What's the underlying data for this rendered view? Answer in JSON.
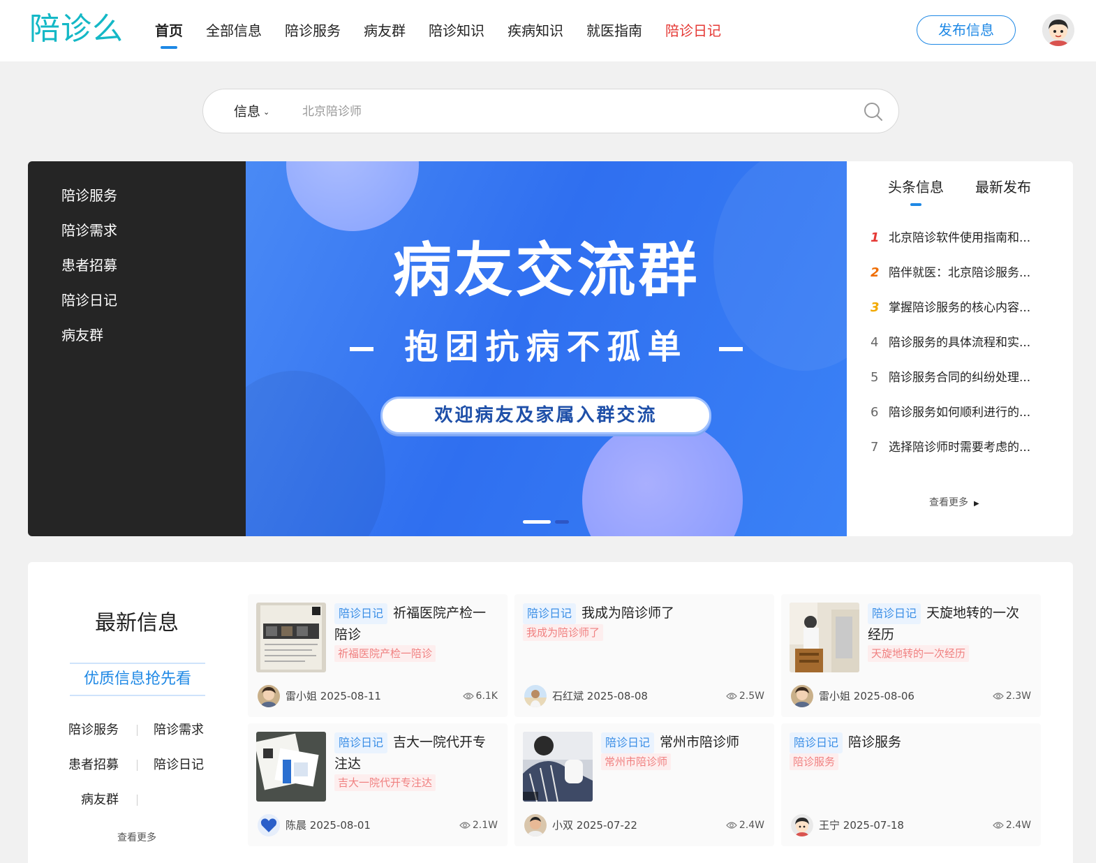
{
  "header": {
    "logo": "陪诊么",
    "nav": [
      {
        "label": "首页"
      },
      {
        "label": "全部信息"
      },
      {
        "label": "陪诊服务"
      },
      {
        "label": "病友群"
      },
      {
        "label": "陪诊知识"
      },
      {
        "label": "疾病知识"
      },
      {
        "label": "就医指南"
      },
      {
        "label": "陪诊日记"
      }
    ],
    "publish_label": "发布信息"
  },
  "search": {
    "type_label": "信息",
    "placeholder": "北京陪诊师"
  },
  "category_menu": [
    "陪诊服务",
    "陪诊需求",
    "患者招募",
    "陪诊日记",
    "病友群"
  ],
  "banner": {
    "title": "病友交流群",
    "subtitle": "抱团抗病不孤单",
    "pill": "欢迎病友及家属入群交流",
    "slide_count": 2,
    "active_slide": 1
  },
  "news_panel": {
    "tabs": [
      "头条信息",
      "最新发布"
    ],
    "items": [
      {
        "rank": "1",
        "title": "北京陪诊软件使用指南和..."
      },
      {
        "rank": "2",
        "title": "陪伴就医：北京陪诊服务..."
      },
      {
        "rank": "3",
        "title": "掌握陪诊服务的核心内容..."
      },
      {
        "rank": "4",
        "title": "陪诊服务的具体流程和实..."
      },
      {
        "rank": "5",
        "title": "陪诊服务合同的纠纷处理..."
      },
      {
        "rank": "6",
        "title": "陪诊服务如何顺利进行的..."
      },
      {
        "rank": "7",
        "title": "选择陪诊师时需要考虑的..."
      }
    ],
    "more_label": "查看更多"
  },
  "latest": {
    "title": "最新信息",
    "subtitle": "优质信息抢先看",
    "categories": [
      "陪诊服务",
      "陪诊需求",
      "患者招募",
      "陪诊日记",
      "病友群"
    ],
    "more_label": "查看更多",
    "cards": [
      {
        "tag": "陪诊日记",
        "title": "祈福医院产检一陪诊",
        "subtag": "祈福医院产检一陪诊",
        "author": "雷小姐",
        "date": "2025-08-11",
        "views": "6.1K",
        "thumb": "document"
      },
      {
        "tag": "陪诊日记",
        "title": "我成为陪诊师了",
        "subtag": "我成为陪诊师了",
        "author": "石红斌",
        "date": "2025-08-08",
        "views": "2.5W",
        "thumb": "none"
      },
      {
        "tag": "陪诊日记",
        "title": "天旋地转的一次经历",
        "subtag": "天旋地转的一次经历",
        "author": "雷小姐",
        "date": "2025-08-06",
        "views": "2.3W",
        "thumb": "clinic"
      },
      {
        "tag": "陪诊日记",
        "title": "吉大一院代开专注达",
        "subtag": "吉大一院代开专注达",
        "author": "陈晨",
        "date": "2025-08-01",
        "views": "2.1W",
        "thumb": "medicine"
      },
      {
        "tag": "陪诊日记",
        "title": "常州市陪诊师",
        "subtag": "常州市陪诊师",
        "author": "小双",
        "date": "2025-07-22",
        "views": "2.4W",
        "thumb": "patient"
      },
      {
        "tag": "陪诊日记",
        "title": "陪诊服务",
        "subtag": "陪诊服务",
        "author": "王宁",
        "date": "2025-07-18",
        "views": "2.4W",
        "thumb": "none"
      }
    ]
  },
  "colors": {
    "brand": "#14b8c6",
    "accent": "#1e88e5",
    "highlight_red": "#e53935"
  }
}
